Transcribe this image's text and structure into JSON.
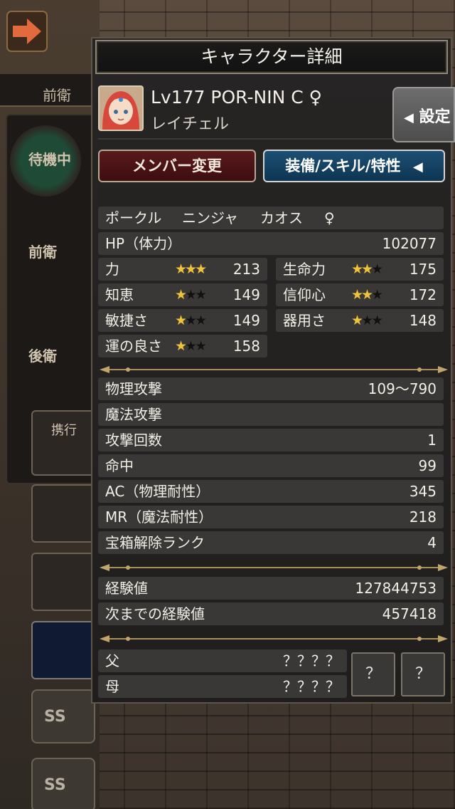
{
  "background": {
    "tab_label": "前衛",
    "standby_label": "待機中",
    "front_label": "前衛",
    "back_label": "後衛",
    "carry_label": "携行",
    "ss_label": "SS"
  },
  "panel": {
    "title": "キャラクター詳細"
  },
  "character": {
    "level_line": "Lv177 POR-NIN C ♀",
    "name": "レイチェル"
  },
  "settings_button": {
    "icon": "◀",
    "label": "設定"
  },
  "buttons": {
    "member_change": "メンバー変更",
    "equip_skill": "装備/スキル/特性",
    "equip_icon": "◀"
  },
  "profile": {
    "race": "ポークル",
    "class": "ニンジャ",
    "alignment": "カオス",
    "gender": "♀"
  },
  "hp": {
    "label": "HP（体力）",
    "value": "102077"
  },
  "stats": [
    {
      "label": "力",
      "stars": 3,
      "value": "213"
    },
    {
      "label": "生命力",
      "stars": 2,
      "value": "175"
    },
    {
      "label": "知恵",
      "stars": 1,
      "value": "149"
    },
    {
      "label": "信仰心",
      "stars": 2,
      "value": "172"
    },
    {
      "label": "敏捷さ",
      "stars": 1,
      "value": "149"
    },
    {
      "label": "器用さ",
      "stars": 1,
      "value": "148"
    },
    {
      "label": "運の良さ",
      "stars": 1,
      "value": "158"
    }
  ],
  "combat": [
    {
      "label": "物理攻撃",
      "value": "109～790"
    },
    {
      "label": "魔法攻撃",
      "value": ""
    },
    {
      "label": "攻撃回数",
      "value": "1"
    },
    {
      "label": "命中",
      "value": "99"
    },
    {
      "label": "AC（物理耐性）",
      "value": "345"
    },
    {
      "label": "MR（魔法耐性）",
      "value": "218"
    },
    {
      "label": "宝箱解除ランク",
      "value": "4"
    }
  ],
  "experience": [
    {
      "label": "経験値",
      "value": "127844753"
    },
    {
      "label": "次までの経験値",
      "value": "457418"
    }
  ],
  "parents": [
    {
      "label": "父",
      "value": "？？？？"
    },
    {
      "label": "母",
      "value": "？？？？"
    }
  ],
  "parent_slots": [
    "？",
    "？"
  ],
  "colors": {
    "star_on": "#f0c43a",
    "member_button": "#5a1a1c",
    "equip_button": "#1d4f74"
  }
}
